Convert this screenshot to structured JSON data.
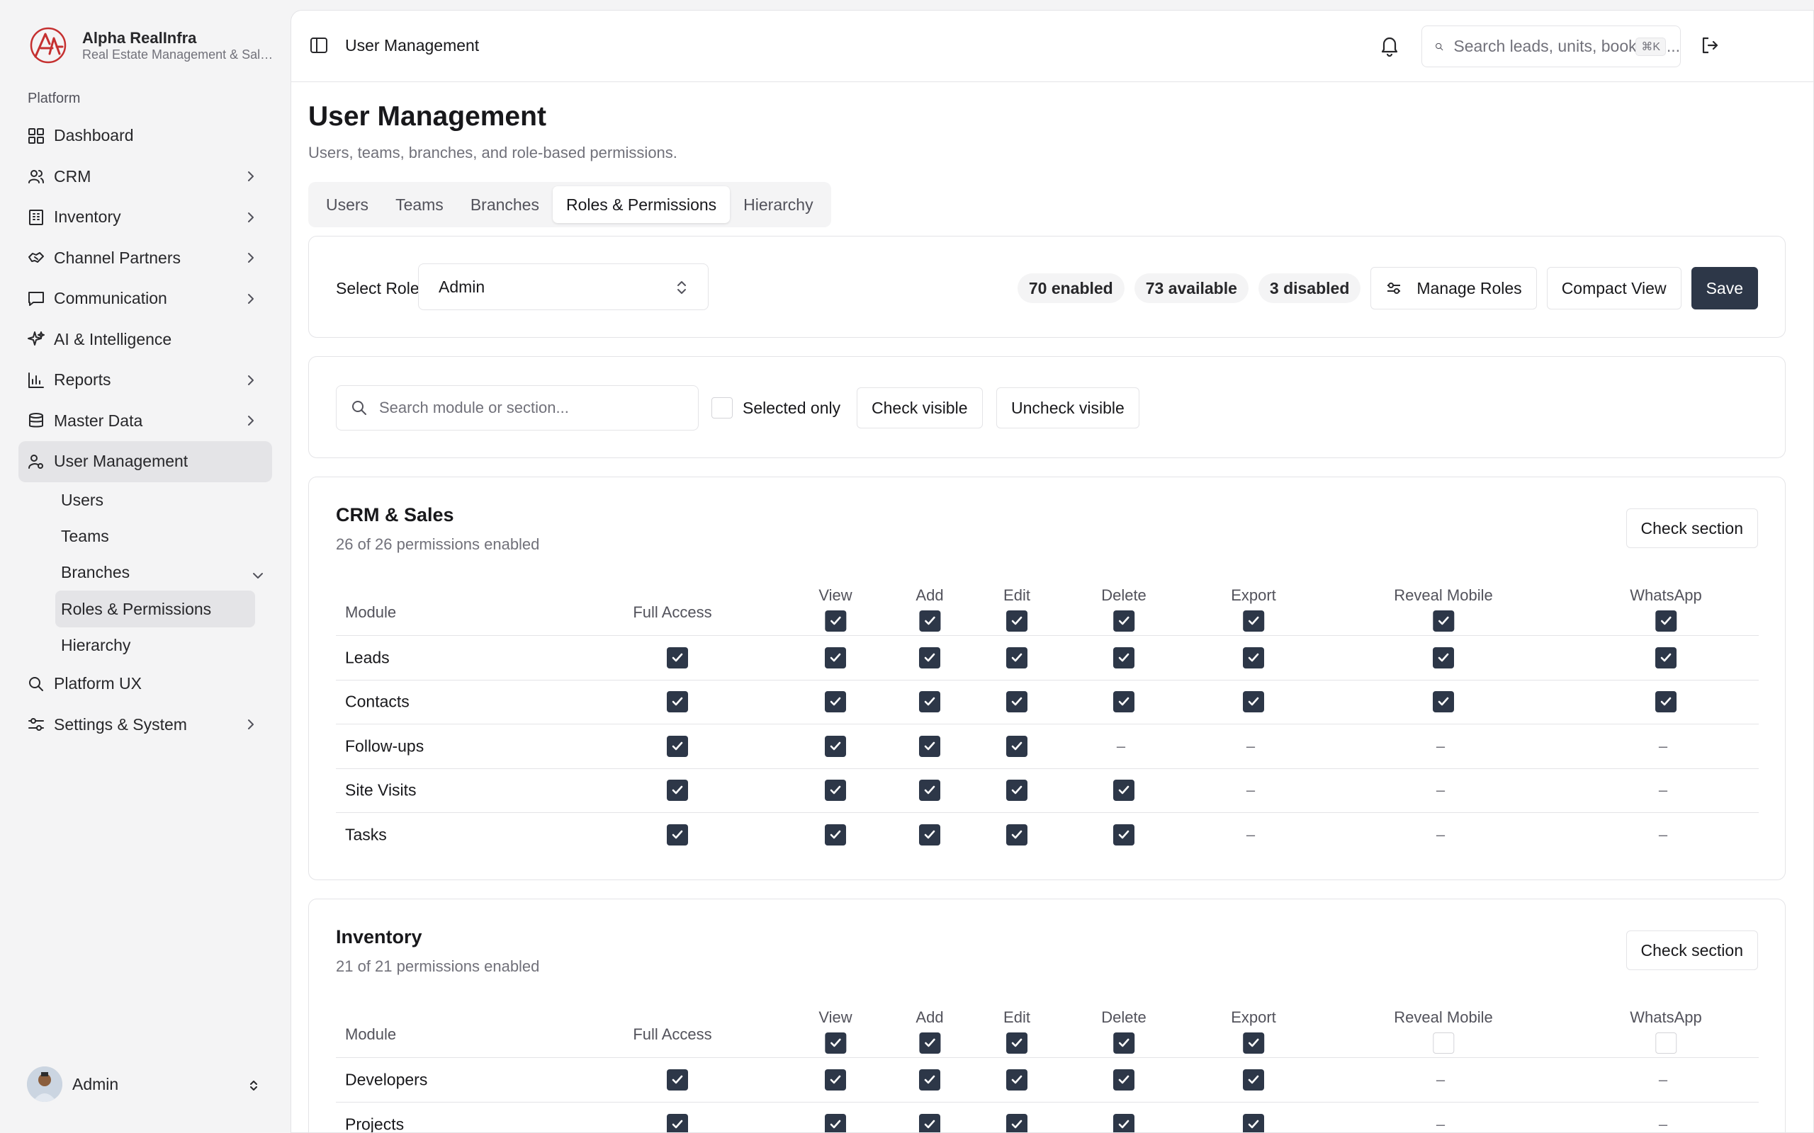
{
  "brand": {
    "name": "Alpha RealInfra",
    "subtitle": "Real Estate Management & Sales",
    "logo_color": "#c53030"
  },
  "sidebar": {
    "group_label": "Platform",
    "items": [
      {
        "label": "Dashboard",
        "icon": "dashboard-icon",
        "chevron": false
      },
      {
        "label": "CRM",
        "icon": "users-icon",
        "chevron": true
      },
      {
        "label": "Inventory",
        "icon": "building-icon",
        "chevron": true
      },
      {
        "label": "Channel Partners",
        "icon": "handshake-icon",
        "chevron": true
      },
      {
        "label": "Communication",
        "icon": "message-icon",
        "chevron": true
      },
      {
        "label": "AI & Intelligence",
        "icon": "sparkles-icon",
        "chevron": false
      },
      {
        "label": "Reports",
        "icon": "bar-chart-icon",
        "chevron": true
      },
      {
        "label": "Master Data",
        "icon": "database-icon",
        "chevron": true
      },
      {
        "label": "User Management",
        "icon": "user-cog-icon",
        "chevron": false,
        "active": true
      }
    ],
    "sub_items": [
      "Users",
      "Teams",
      "Branches",
      "Roles & Permissions",
      "Hierarchy"
    ],
    "active_sub": "Roles & Permissions",
    "after_items": [
      {
        "label": "Platform UX",
        "icon": "search-icon",
        "chevron": false
      },
      {
        "label": "Settings & System",
        "icon": "sliders-icon",
        "chevron": true
      }
    ],
    "user": {
      "name": "Admin"
    }
  },
  "topbar": {
    "title": "User Management",
    "search_placeholder": "Search leads, units, bookings...",
    "shortcut": "⌘K"
  },
  "page": {
    "title": "User Management",
    "subtitle": "Users, teams, branches, and role-based permissions."
  },
  "tabs": [
    {
      "label": "Users",
      "active": false
    },
    {
      "label": "Teams",
      "active": false
    },
    {
      "label": "Branches",
      "active": false
    },
    {
      "label": "Roles & Permissions",
      "active": true
    },
    {
      "label": "Hierarchy",
      "active": false
    }
  ],
  "role": {
    "label": "Select Role",
    "selected": "Admin",
    "badges": {
      "enabled": "70 enabled",
      "available": "73 available",
      "disabled": "3 disabled"
    },
    "manage_label": "Manage Roles",
    "compact_label": "Compact View",
    "save_label": "Save"
  },
  "filters": {
    "search_placeholder": "Search module or section...",
    "selected_only": "Selected only",
    "check_visible": "Check visible",
    "uncheck_visible": "Uncheck visible"
  },
  "columns": [
    "Module",
    "Full Access",
    "View",
    "Add",
    "Edit",
    "Delete",
    "Export",
    "Reveal Mobile",
    "WhatsApp"
  ],
  "sections": [
    {
      "title": "CRM & Sales",
      "summary": "26 of 26 permissions enabled",
      "check_label": "Check section",
      "header_checks": [
        true,
        true,
        true,
        true,
        true,
        true,
        true
      ],
      "rows": [
        {
          "module": "Leads",
          "full": true,
          "cells": [
            true,
            true,
            true,
            true,
            true,
            true,
            true
          ]
        },
        {
          "module": "Contacts",
          "full": true,
          "cells": [
            true,
            true,
            true,
            true,
            true,
            true,
            true
          ]
        },
        {
          "module": "Follow-ups",
          "full": true,
          "cells": [
            true,
            true,
            true,
            null,
            null,
            null,
            null
          ]
        },
        {
          "module": "Site Visits",
          "full": true,
          "cells": [
            true,
            true,
            true,
            true,
            null,
            null,
            null
          ]
        },
        {
          "module": "Tasks",
          "full": true,
          "cells": [
            true,
            true,
            true,
            true,
            null,
            null,
            null
          ]
        }
      ]
    },
    {
      "title": "Inventory",
      "summary": "21 of 21 permissions enabled",
      "check_label": "Check section",
      "header_checks": [
        true,
        true,
        true,
        true,
        true,
        false,
        false
      ],
      "rows": [
        {
          "module": "Developers",
          "full": true,
          "cells": [
            true,
            true,
            true,
            true,
            true,
            null,
            null
          ]
        },
        {
          "module": "Projects",
          "full": true,
          "cells": [
            true,
            true,
            true,
            true,
            true,
            null,
            null
          ]
        }
      ]
    }
  ],
  "dash_symbol": "–",
  "colors": {
    "primary": "#2d3748",
    "muted": "#71717a",
    "border": "#e4e4e7",
    "sidebar_bg": "#f4f4f5"
  }
}
